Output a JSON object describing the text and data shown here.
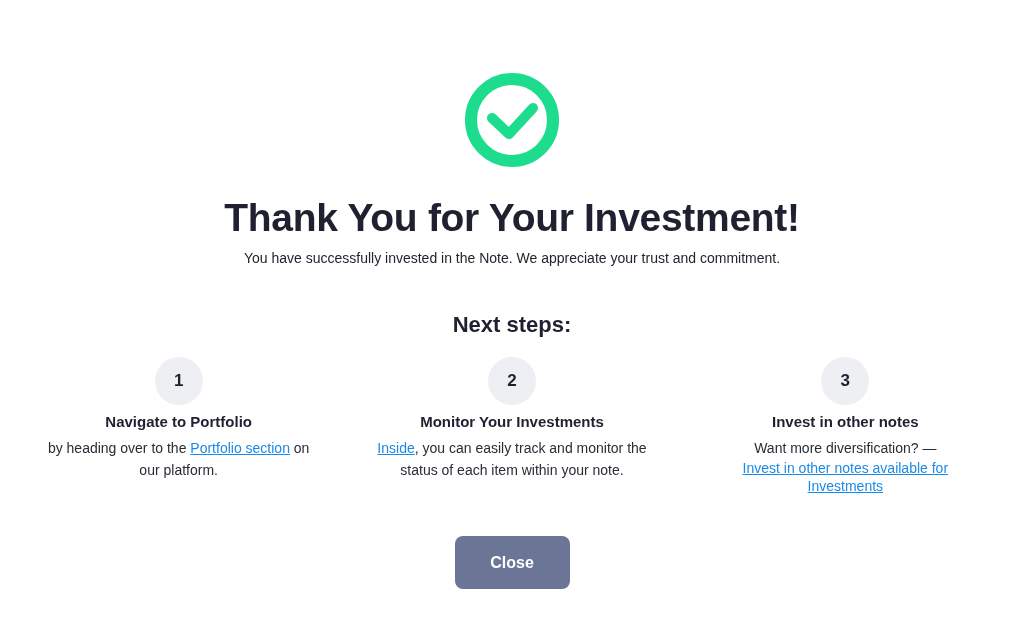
{
  "title": "Thank You for Your Investment!",
  "message": "You have successfully invested in the Note. We appreciate your trust and commitment.",
  "next_steps": {
    "heading": "Next steps:",
    "steps": [
      {
        "number": "1",
        "title": "Navigate to Portfolio",
        "description": [
          {
            "kind": "text",
            "text": "by heading over to the "
          },
          {
            "kind": "link",
            "text": "Portfolio section"
          },
          {
            "kind": "text",
            "text": " on our platform."
          }
        ]
      },
      {
        "number": "2",
        "title": "Monitor Your Investments",
        "description": [
          {
            "kind": "link",
            "text": "Inside"
          },
          {
            "kind": "text",
            "text": ", you can easily track and monitor the status of each item within your note."
          }
        ]
      },
      {
        "number": "3",
        "title": "Invest in other notes",
        "description": [
          {
            "kind": "text",
            "text": "Want more diversification? —"
          }
        ],
        "link": "Invest in other notes available for Investments"
      }
    ]
  },
  "close_button": "Close"
}
